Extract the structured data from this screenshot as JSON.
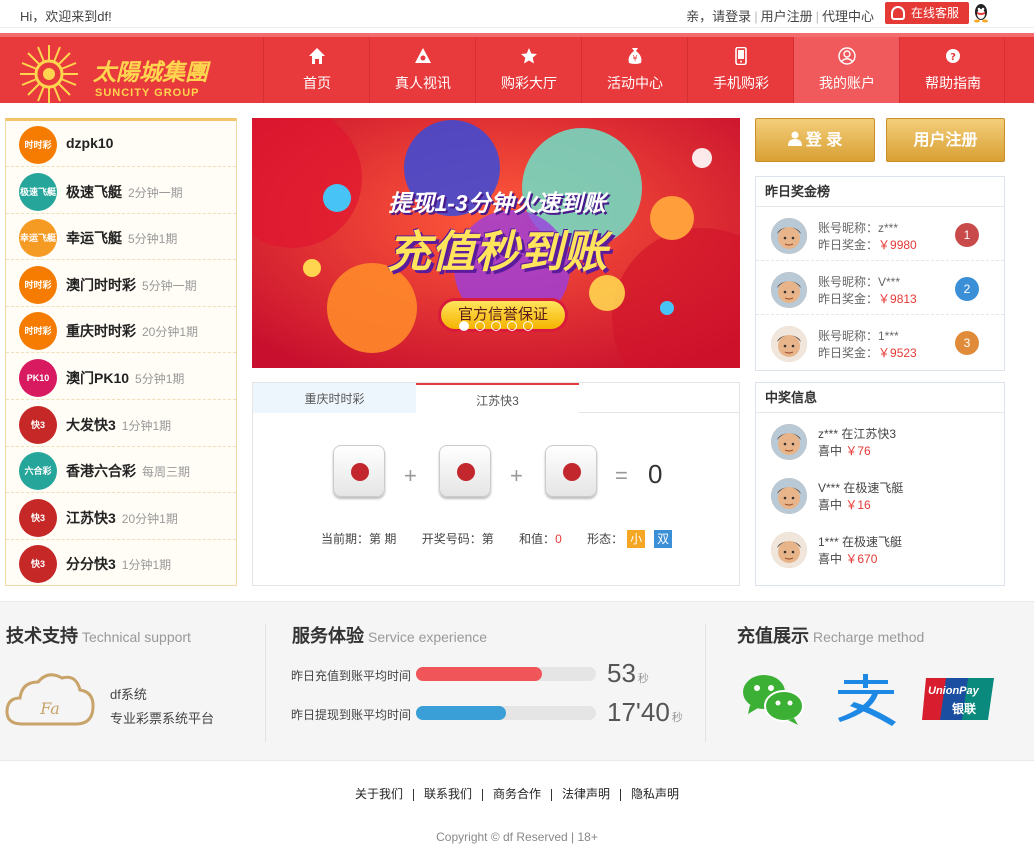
{
  "topbar": {
    "welcome": "Hi，欢迎来到df!",
    "greet": "亲，请登录",
    "register": "用户注册",
    "agent": "代理中心",
    "service": "在线客服"
  },
  "logo": {
    "cn": "太陽城集團",
    "en": "SUNCITY GROUP"
  },
  "nav": [
    {
      "label": "首页",
      "icon": "home-icon"
    },
    {
      "label": "真人视讯",
      "icon": "video-icon"
    },
    {
      "label": "购彩大厅",
      "icon": "star-icon"
    },
    {
      "label": "活动中心",
      "icon": "money-bag-icon"
    },
    {
      "label": "手机购彩",
      "icon": "mobile-icon"
    },
    {
      "label": "我的账户",
      "icon": "user-icon"
    },
    {
      "label": "帮助指南",
      "icon": "help-icon"
    }
  ],
  "lotteries": [
    {
      "name": "dzpk10",
      "period": "",
      "badge": "时时彩",
      "color": "#f57c00"
    },
    {
      "name": "极速飞艇",
      "period": "2分钟一期",
      "badge": "极速飞艇",
      "color": "#26a69a"
    },
    {
      "name": "幸运飞艇",
      "period": "5分钟1期",
      "badge": "幸运飞艇",
      "color": "#f59a23"
    },
    {
      "name": "澳门时时彩",
      "period": "5分钟一期",
      "badge": "时时彩",
      "color": "#f57c00"
    },
    {
      "name": "重庆时时彩",
      "period": "20分钟1期",
      "badge": "时时彩",
      "color": "#f57c00"
    },
    {
      "name": "澳门PK10",
      "period": "5分钟1期",
      "badge": "PK10",
      "color": "#d81b60"
    },
    {
      "name": "大发快3",
      "period": "1分钟1期",
      "badge": "快3",
      "color": "#c62828"
    },
    {
      "name": "香港六合彩",
      "period": "每周三期",
      "badge": "六合彩",
      "color": "#26a69a"
    },
    {
      "name": "江苏快3",
      "period": "20分钟1期",
      "badge": "快3",
      "color": "#c62828"
    },
    {
      "name": "分分快3",
      "period": "1分钟1期",
      "badge": "快3",
      "color": "#c62828"
    }
  ],
  "banner": {
    "line1": "提现1-3分钟火速到账",
    "line2": "充值秒到账",
    "button": "官方信誉保证",
    "dots": 5
  },
  "draw": {
    "tabs": [
      "重庆时时彩",
      "江苏快3"
    ],
    "plus": "+",
    "equals": "=",
    "sum": "0",
    "cur_label": "当前期：第  期",
    "open_label": "开奖号码：第",
    "sum_label": "和值：",
    "sum_value": "0",
    "shape_label": "形态：",
    "tag_small": "小",
    "tag_even": "双"
  },
  "buttons": {
    "login": "登 录",
    "register": "用户注册"
  },
  "yesterday": {
    "title": "昨日奖金榜",
    "rows": [
      {
        "nick": "账号昵称：z***",
        "bonus_label": "昨日奖金：",
        "bonus": "￥9980",
        "rank": "1",
        "rank_color": "#c94a4a"
      },
      {
        "nick": "账号昵称：V***",
        "bonus_label": "昨日奖金：",
        "bonus": "￥9813",
        "rank": "2",
        "rank_color": "#3a8fd6"
      },
      {
        "nick": "账号昵称：1***",
        "bonus_label": "昨日奖金：",
        "bonus": "￥9523",
        "rank": "3",
        "rank_color": "#e08b3a"
      }
    ]
  },
  "wins": {
    "title": "中奖信息",
    "rows": [
      {
        "line1": "z*** 在江苏快3",
        "win_label": "喜中",
        "amount": "￥76"
      },
      {
        "line1": "V*** 在极速飞艇",
        "win_label": "喜中",
        "amount": "￥16"
      },
      {
        "line1": "1*** 在极速飞艇",
        "win_label": "喜中",
        "amount": "￥670"
      }
    ]
  },
  "support": {
    "title": "技术支持",
    "en": "Technical support",
    "name": "df系统",
    "desc": "专业彩票系统平台",
    "logo_text": "Fa"
  },
  "service": {
    "title": "服务体验",
    "en": "Service experience",
    "recharge_label": "昨日充值到账平均时间",
    "recharge_value": "53",
    "recharge_unit": "秒",
    "recharge_fill": 0.7,
    "withdraw_label": "昨日提现到账平均时间",
    "withdraw_value": "17'40",
    "withdraw_unit": "秒",
    "withdraw_fill": 0.5
  },
  "recharge": {
    "title": "充值展示",
    "en": "Recharge method",
    "unionpay": "UnionPay",
    "unionpay_cn": "银联"
  },
  "footer": {
    "links": [
      "关于我们",
      "联系我们",
      "商务合作",
      "法律声明",
      "隐私声明"
    ],
    "copyright": "Copyright © df Reserved | 18+"
  }
}
